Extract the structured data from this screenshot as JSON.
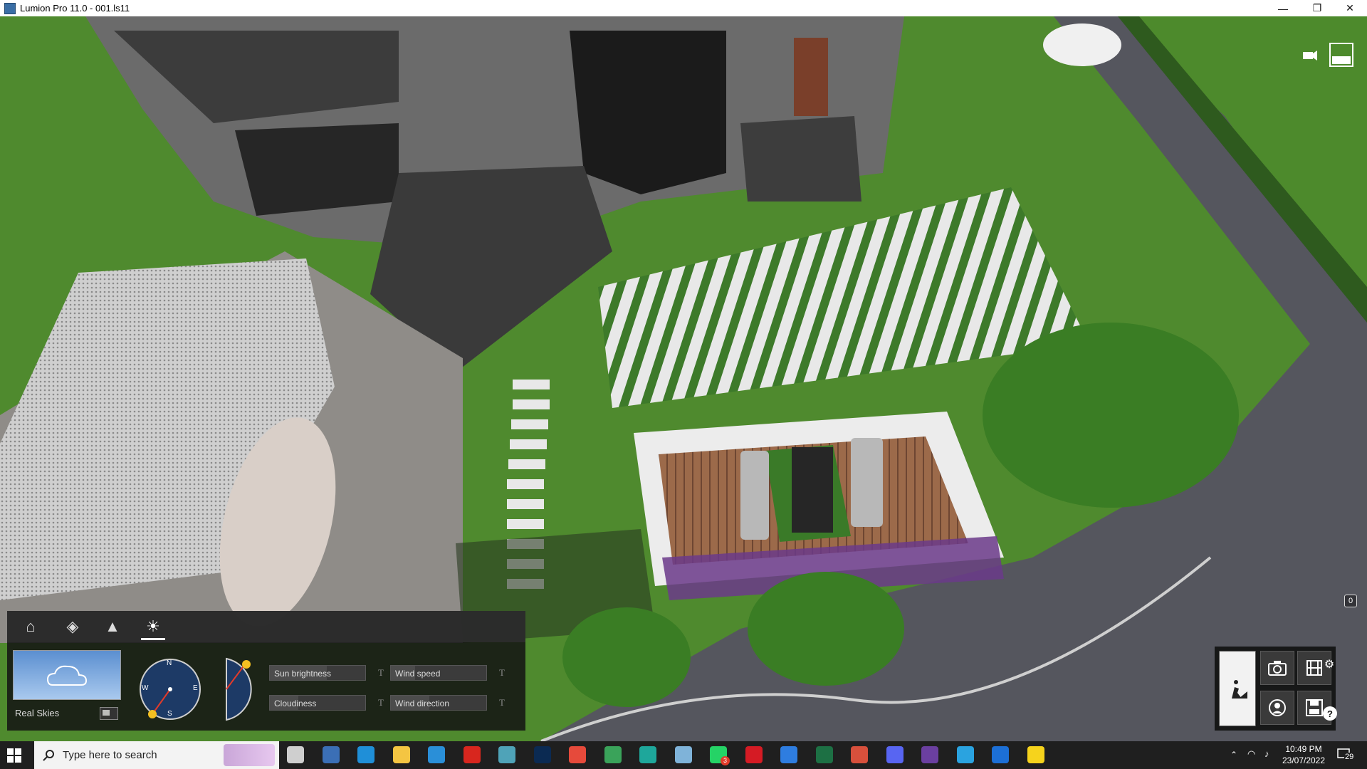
{
  "window": {
    "title": "Lumion Pro 11.0 - 001.ls11",
    "controls": {
      "minimize": "—",
      "restore": "❐",
      "close": "✕"
    }
  },
  "viewport": {
    "top_right": {
      "camera_icon": "video-camera-icon",
      "swatch_icon": "white-rectangle-icon"
    },
    "hud_badge": "0"
  },
  "weather_panel": {
    "tabs": [
      {
        "icon": "home-icon",
        "glyph": "⌂"
      },
      {
        "icon": "paint-bucket-icon",
        "glyph": "◈"
      },
      {
        "icon": "landscape-icon",
        "glyph": "▲"
      },
      {
        "icon": "sun-icon",
        "glyph": "☀"
      }
    ],
    "active_tab": 3,
    "sky_label": "Real Skies",
    "compass_letters": {
      "n": "N",
      "e": "E",
      "s": "S",
      "w": "W"
    },
    "sliders": {
      "sun_brightness": "Sun brightness",
      "cloudiness": "Cloudiness",
      "wind_speed": "Wind speed",
      "wind_direction": "Wind direction"
    },
    "text_toggle": "T"
  },
  "mode_panel": {
    "buttons": [
      {
        "name": "build-mode-icon"
      },
      {
        "name": "photo-mode-icon"
      },
      {
        "name": "movie-mode-icon"
      },
      {
        "name": "panorama-mode-icon"
      },
      {
        "name": "save-icon"
      }
    ],
    "settings_glyph": "⚙",
    "help_glyph": "?"
  },
  "taskbar": {
    "search_placeholder": "Type here to search",
    "time": "10:49 PM",
    "date": "23/07/2022",
    "notification_count": "29",
    "whatsapp_badge": "3",
    "apps": [
      {
        "name": "task-view-icon",
        "color": "#cfcfcf"
      },
      {
        "name": "calculator-icon",
        "color": "#3b6fb6"
      },
      {
        "name": "edge-icon",
        "color": "#1f8fd8"
      },
      {
        "name": "file-explorer-icon",
        "color": "#f4c542"
      },
      {
        "name": "shield-app-icon",
        "color": "#2a8fd8"
      },
      {
        "name": "acrobat-icon",
        "color": "#d8261e"
      },
      {
        "name": "snipping-tool-icon",
        "color": "#4fa3b8"
      },
      {
        "name": "photoshop-icon",
        "color": "#0b2a52"
      },
      {
        "name": "chrome-icon",
        "color": "#e64a3b"
      },
      {
        "name": "chrome-profile-icon",
        "color": "#3aa35a"
      },
      {
        "name": "sketchup-icon",
        "color": "#1ea79b"
      },
      {
        "name": "notes-app-icon",
        "color": "#7fb3d9"
      },
      {
        "name": "whatsapp-icon",
        "color": "#25d366"
      },
      {
        "name": "opera-icon",
        "color": "#d51b24"
      },
      {
        "name": "todo-icon",
        "color": "#2e7de0"
      },
      {
        "name": "excel-icon",
        "color": "#1d7044"
      },
      {
        "name": "grammarly-icon",
        "color": "#d8503c"
      },
      {
        "name": "discord-icon",
        "color": "#5865f2"
      },
      {
        "name": "podcast-icon",
        "color": "#6b3fa0"
      },
      {
        "name": "telegram-icon",
        "color": "#2aa3e0"
      },
      {
        "name": "cube-app-icon",
        "color": "#1c6fd6"
      },
      {
        "name": "sticky-notes-icon",
        "color": "#f6d31c"
      }
    ]
  }
}
